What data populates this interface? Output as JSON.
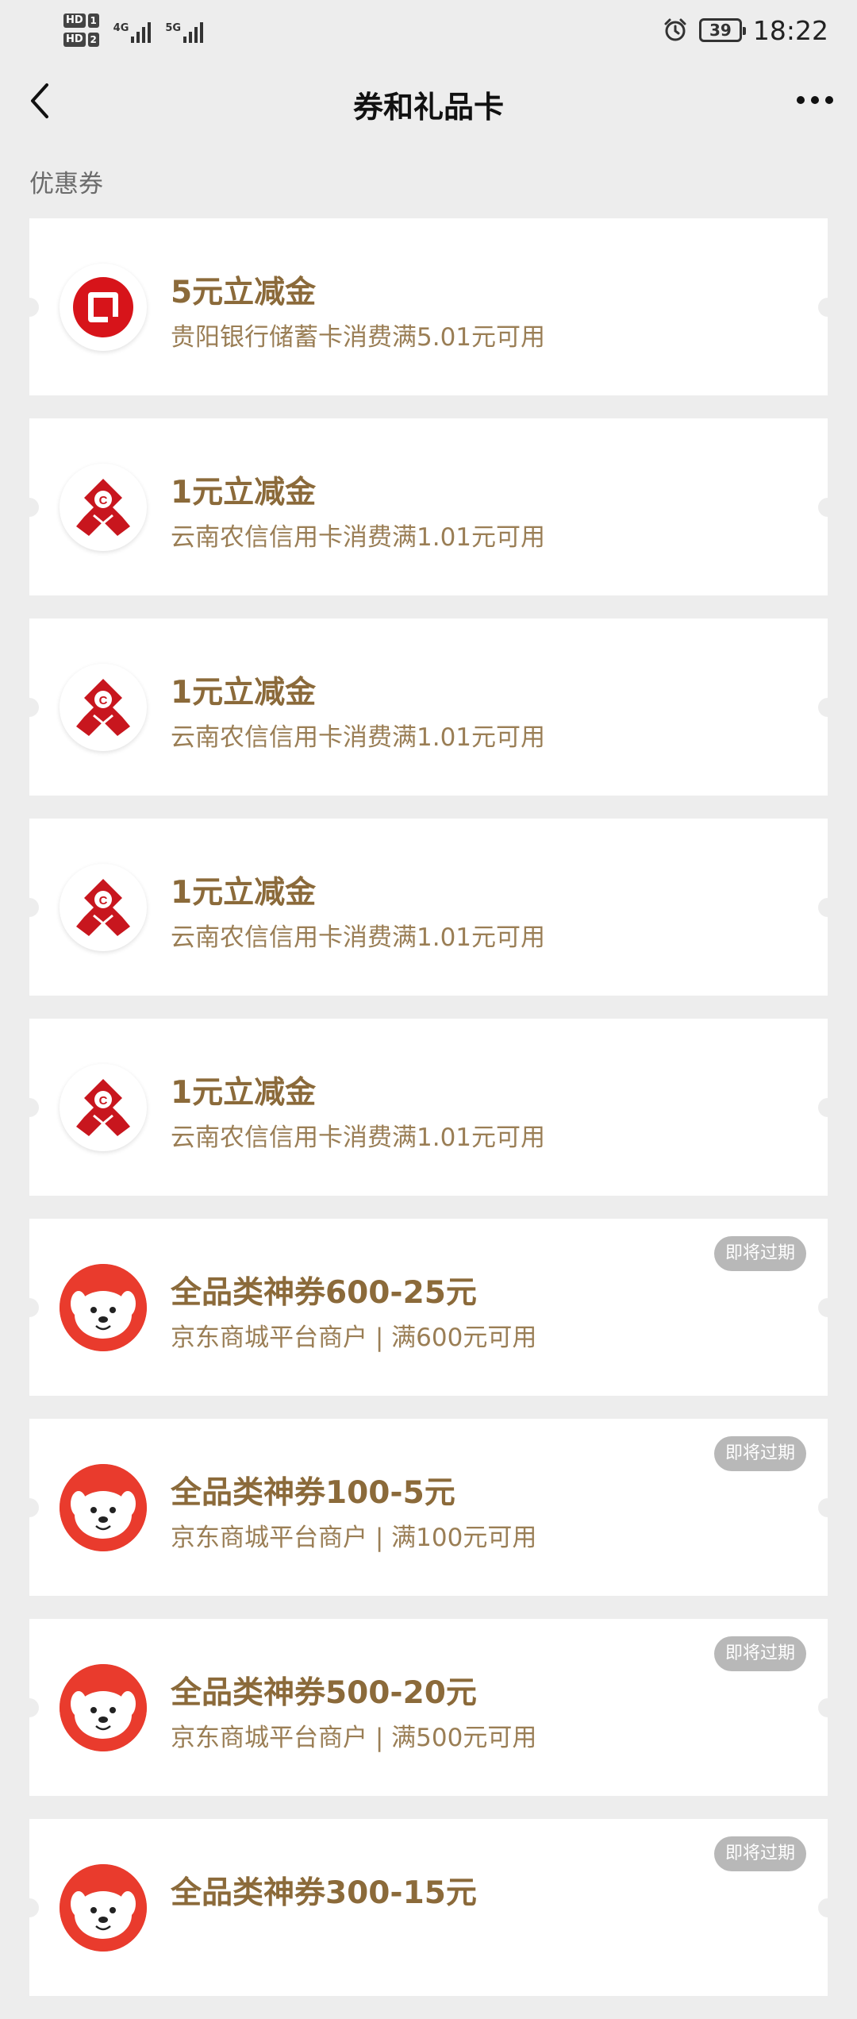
{
  "status_bar": {
    "hd1": "HD",
    "hd1_num": "1",
    "hd2": "HD",
    "hd2_num": "2",
    "net1": "4G",
    "net2": "5G",
    "battery": "39",
    "time": "18:22"
  },
  "nav": {
    "title": "券和礼品卡"
  },
  "section_label": "优惠券",
  "coupons": [
    {
      "title": "5元立减金",
      "desc": "贵阳银行储蓄卡消费满5.01元可用",
      "logo": "guiyang-bank-logo",
      "badge": ""
    },
    {
      "title": "1元立减金",
      "desc": "云南农信信用卡消费满1.01元可用",
      "logo": "yunnan-rural-credit-logo",
      "badge": ""
    },
    {
      "title": "1元立减金",
      "desc": "云南农信信用卡消费满1.01元可用",
      "logo": "yunnan-rural-credit-logo",
      "badge": ""
    },
    {
      "title": "1元立减金",
      "desc": "云南农信信用卡消费满1.01元可用",
      "logo": "yunnan-rural-credit-logo",
      "badge": ""
    },
    {
      "title": "1元立减金",
      "desc": "云南农信信用卡消费满1.01元可用",
      "logo": "yunnan-rural-credit-logo",
      "badge": ""
    },
    {
      "title": "全品类神券600-25元",
      "desc": "京东商城平台商户 | 满600元可用",
      "logo": "jd-joy-logo",
      "badge": "即将过期"
    },
    {
      "title": "全品类神券100-5元",
      "desc": "京东商城平台商户 | 满100元可用",
      "logo": "jd-joy-logo",
      "badge": "即将过期"
    },
    {
      "title": "全品类神券500-20元",
      "desc": "京东商城平台商户 | 满500元可用",
      "logo": "jd-joy-logo",
      "badge": "即将过期"
    },
    {
      "title": "全品类神券300-15元",
      "desc": "",
      "logo": "jd-joy-logo",
      "badge": "即将过期"
    }
  ],
  "colors": {
    "background": "#ededed",
    "title_gold": "#8b6a3a",
    "desc_gold": "#9a7e55",
    "badge_gray": "#b8b8b8",
    "jd_red": "#e93b2d",
    "bank_red": "#d7141a"
  }
}
